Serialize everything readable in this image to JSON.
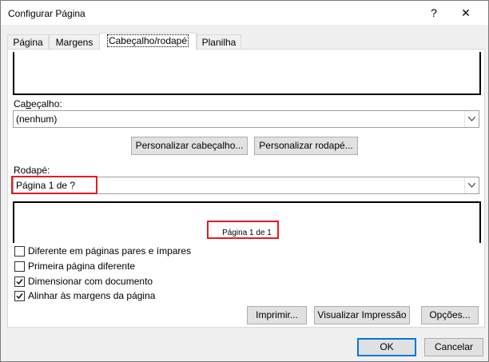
{
  "window": {
    "title": "Configurar Página",
    "help": "?",
    "close": "✕"
  },
  "tabs": [
    {
      "label": "Página"
    },
    {
      "label": "Margens"
    },
    {
      "label": "Cabeçalho/rodapé"
    },
    {
      "label": "Planilha"
    }
  ],
  "header": {
    "label": "Cabeçalho:",
    "selected": "(nenhum)",
    "customize_button": "Personalizar cabeçalho...",
    "footer_customize_button": "Personalizar rodapé..."
  },
  "footer": {
    "label": "Rodapé:",
    "selected": "Página 1 de ?",
    "preview_text": "Página 1 de 1"
  },
  "options": [
    {
      "label": "Diferente em páginas pares e ímpares",
      "checked": false
    },
    {
      "label": "Primeira página diferente",
      "checked": false
    },
    {
      "label": "Dimensionar com documento",
      "checked": true
    },
    {
      "label": "Alinhar às margens da página",
      "checked": true
    }
  ],
  "buttons": {
    "print": "Imprimir...",
    "preview": "Visualizar Impressão",
    "options": "Opções...",
    "ok": "OK",
    "cancel": "Cancelar"
  }
}
